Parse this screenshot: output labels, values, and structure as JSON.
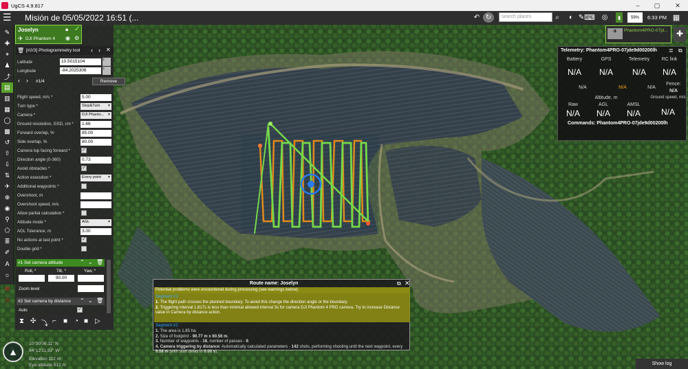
{
  "window": {
    "title": "UgCS 4.9.817"
  },
  "header": {
    "mission_title": "Misión de 05/05/2022 16:51 (...",
    "search_placeholder": "search places",
    "battery": "59%",
    "time": "6:33 PM"
  },
  "vehicle": {
    "name": "Joselyn",
    "model": "DJI Phantom 4",
    "top_card_label": "Phantom4PRO-07jd..."
  },
  "tool": {
    "title": "[#2/3] Photogrammetry tool",
    "latitude_label": "Latitude",
    "latitude": "10.5015104",
    "longitude_label": "Longitude",
    "longitude": "-84.2025306",
    "point_label": "#1/4",
    "remove_label": "Remove",
    "fields": [
      {
        "label": "Flight speed, m/s *",
        "value": "5.00",
        "kind": "input"
      },
      {
        "label": "Turn type *",
        "value": "Stop&Turn",
        "kind": "select"
      },
      {
        "label": "Camera *",
        "value": "DJI Phanto...",
        "kind": "select"
      },
      {
        "label": "Ground resolution, GSD, cm *",
        "value": "1.66",
        "kind": "input"
      },
      {
        "label": "Forward overlap, %",
        "value": "85.00",
        "kind": "input"
      },
      {
        "label": "Side overlap, %",
        "value": "80.00",
        "kind": "input"
      },
      {
        "label": "Camera top facing forward *",
        "value": "",
        "kind": "check-on"
      },
      {
        "label": "Direction angle (0-360)",
        "value": "0.73",
        "kind": "input"
      },
      {
        "label": "Avoid obstacles *",
        "value": "",
        "kind": "check-on"
      },
      {
        "label": "Action execution *",
        "value": "Every point",
        "kind": "select"
      },
      {
        "label": "Additional waypoints *",
        "value": "",
        "kind": "check-off"
      },
      {
        "label": "Overshoot, m",
        "value": "",
        "kind": "input"
      },
      {
        "label": "Overshoot speed, m/s",
        "value": "",
        "kind": "input"
      },
      {
        "label": "Allow partial calculation *",
        "value": "",
        "kind": "check-off"
      },
      {
        "label": "Altitude mode *",
        "value": "AGL",
        "kind": "select"
      },
      {
        "label": "AGL Tolerance, m",
        "value": "3.00",
        "kind": "input"
      },
      {
        "label": "No actions at last point *",
        "value": "",
        "kind": "check-on"
      },
      {
        "label": "Double grid *",
        "value": "",
        "kind": "check-off"
      }
    ],
    "action1": {
      "title": "#1 Set camera attitude",
      "roll_label": "Roll, *",
      "tilt_label": "Tilt, *",
      "yaw_label": "Yaw, *",
      "tilt_value": "90.00",
      "zoom_label": "Zoom level"
    },
    "action2": {
      "title": "#2 Set camera by distance",
      "auto_label": "Auto"
    }
  },
  "telemetry": {
    "title": "Telemetry: Phantom4PRO-07jde9d00200lh",
    "battery_label": "Battery",
    "gps_label": "GPS",
    "telemetry_label": "Telemetry",
    "rc_label": "RC link",
    "na": "N/A",
    "fence_label": "Fence:",
    "altitude_label": "Altitude, m",
    "raw_label": "Raw",
    "agl_label": "AGL",
    "amsl_label": "AMSL",
    "ground_speed_label": "Ground speed, m/s",
    "commands": "Commands: Phantom4PRO-07jde9d00200lh"
  },
  "route": {
    "title": "Route name: Joselyn",
    "problems": "Potential problems were encountered during processing (see warnings below).",
    "seg2_title": "Segment #2:",
    "warn1_num": "1.",
    "warn1": "The flight path crosses the planned boundary. To avoid this change the direction angle or the boundary.",
    "warn2_num": "2.",
    "warn2": "Triggering interval 1.817s is less than minimal allowed interval 3s for camera DJI Phantom 4 PRO camera. Try to increase Distance value in Camera by distance action.",
    "info1_pre": "The area is 1.85 ha.",
    "info2_pre": "Size of footprint - ",
    "info2_val": "90.77 m x 60.56 m",
    "info2_post": ".",
    "info3_pre": "Number of waypoints - ",
    "info3_val": "18",
    "info3_mid": ", number of passes - ",
    "info3_val2": "9",
    "info3_post": ".",
    "info4_head": "Camera triggering by distance",
    "info4_a": ": Automatically calculated parameters - ",
    "info4_val": "142",
    "info4_b": " shots, performing shooting until the next waypoint, every ",
    "info4_val2": "9.08 m",
    "info4_c": " (with start delay in ",
    "info4_val3": "0.00 s",
    "info4_d": ")."
  },
  "coords": {
    "lat": "10°30'06.11\" N",
    "lon": "84°12'11.92\" W",
    "elevation": "Elevation 112 m",
    "eye": "Eye altitude 512 m"
  },
  "show_log": "Show log"
}
